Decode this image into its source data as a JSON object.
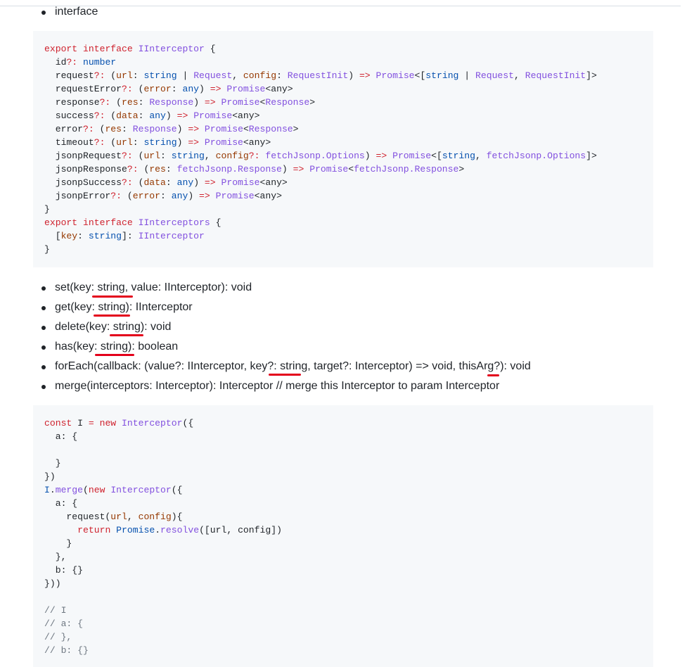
{
  "top_item": "interface",
  "code1": [
    [
      [
        "export ",
        "k"
      ],
      [
        "interface ",
        "k"
      ],
      [
        "IInterceptor",
        "n"
      ],
      [
        " {",
        ""
      ]
    ],
    [
      [
        "  id",
        ""
      ],
      [
        "?: ",
        "k"
      ],
      [
        "number",
        "t"
      ]
    ],
    [
      [
        "  request",
        ""
      ],
      [
        "?: ",
        "k"
      ],
      [
        "(",
        ""
      ],
      [
        "url",
        "p"
      ],
      [
        ": ",
        ""
      ],
      [
        "string",
        "t"
      ],
      [
        " | ",
        ""
      ],
      [
        "Request",
        "n"
      ],
      [
        ", ",
        ""
      ],
      [
        "config",
        "p"
      ],
      [
        ": ",
        ""
      ],
      [
        "RequestInit",
        "n"
      ],
      [
        ") ",
        ""
      ],
      [
        "=>",
        "k"
      ],
      [
        " ",
        ""
      ],
      [
        "Promise",
        "n"
      ],
      [
        "<[",
        ""
      ],
      [
        "string",
        "t"
      ],
      [
        " | ",
        ""
      ],
      [
        "Request",
        "n"
      ],
      [
        ", ",
        ""
      ],
      [
        "RequestInit",
        "n"
      ],
      [
        "]>",
        ""
      ]
    ],
    [
      [
        "  requestError",
        ""
      ],
      [
        "?: ",
        "k"
      ],
      [
        "(",
        ""
      ],
      [
        "error",
        "p"
      ],
      [
        ": ",
        ""
      ],
      [
        "any",
        "t"
      ],
      [
        ") ",
        ""
      ],
      [
        "=>",
        "k"
      ],
      [
        " ",
        ""
      ],
      [
        "Promise",
        "n"
      ],
      [
        "<any>",
        ""
      ]
    ],
    [
      [
        "  response",
        ""
      ],
      [
        "?: ",
        "k"
      ],
      [
        "(",
        ""
      ],
      [
        "res",
        "p"
      ],
      [
        ": ",
        ""
      ],
      [
        "Response",
        "n"
      ],
      [
        ") ",
        ""
      ],
      [
        "=>",
        "k"
      ],
      [
        " ",
        ""
      ],
      [
        "Promise",
        "n"
      ],
      [
        "<",
        ""
      ],
      [
        "Response",
        "n"
      ],
      [
        ">",
        ""
      ]
    ],
    [
      [
        "  success",
        ""
      ],
      [
        "?: ",
        "k"
      ],
      [
        "(",
        ""
      ],
      [
        "data",
        "p"
      ],
      [
        ": ",
        ""
      ],
      [
        "any",
        "t"
      ],
      [
        ") ",
        ""
      ],
      [
        "=>",
        "k"
      ],
      [
        " ",
        ""
      ],
      [
        "Promise",
        "n"
      ],
      [
        "<any>",
        ""
      ]
    ],
    [
      [
        "  error",
        ""
      ],
      [
        "?: ",
        "k"
      ],
      [
        "(",
        ""
      ],
      [
        "res",
        "p"
      ],
      [
        ": ",
        ""
      ],
      [
        "Response",
        "n"
      ],
      [
        ") ",
        ""
      ],
      [
        "=>",
        "k"
      ],
      [
        " ",
        ""
      ],
      [
        "Promise",
        "n"
      ],
      [
        "<",
        ""
      ],
      [
        "Response",
        "n"
      ],
      [
        ">",
        ""
      ]
    ],
    [
      [
        "  timeout",
        ""
      ],
      [
        "?: ",
        "k"
      ],
      [
        "(",
        ""
      ],
      [
        "url",
        "p"
      ],
      [
        ": ",
        ""
      ],
      [
        "string",
        "t"
      ],
      [
        ") ",
        ""
      ],
      [
        "=>",
        "k"
      ],
      [
        " ",
        ""
      ],
      [
        "Promise",
        "n"
      ],
      [
        "<any>",
        ""
      ]
    ],
    [
      [
        "  jsonpRequest",
        ""
      ],
      [
        "?: ",
        "k"
      ],
      [
        "(",
        ""
      ],
      [
        "url",
        "p"
      ],
      [
        ": ",
        ""
      ],
      [
        "string",
        "t"
      ],
      [
        ", ",
        ""
      ],
      [
        "config",
        "p"
      ],
      [
        "?: ",
        "k"
      ],
      [
        "fetchJsonp.Options",
        "n"
      ],
      [
        ") ",
        ""
      ],
      [
        "=>",
        "k"
      ],
      [
        " ",
        ""
      ],
      [
        "Promise",
        "n"
      ],
      [
        "<[",
        ""
      ],
      [
        "string",
        "t"
      ],
      [
        ", ",
        ""
      ],
      [
        "fetchJsonp.Options",
        "n"
      ],
      [
        "]>",
        ""
      ]
    ],
    [
      [
        "  jsonpResponse",
        ""
      ],
      [
        "?: ",
        "k"
      ],
      [
        "(",
        ""
      ],
      [
        "res",
        "p"
      ],
      [
        ": ",
        ""
      ],
      [
        "fetchJsonp.Response",
        "n"
      ],
      [
        ") ",
        ""
      ],
      [
        "=>",
        "k"
      ],
      [
        " ",
        ""
      ],
      [
        "Promise",
        "n"
      ],
      [
        "<",
        ""
      ],
      [
        "fetchJsonp.Response",
        "n"
      ],
      [
        ">",
        ""
      ]
    ],
    [
      [
        "  jsonpSuccess",
        ""
      ],
      [
        "?: ",
        "k"
      ],
      [
        "(",
        ""
      ],
      [
        "data",
        "p"
      ],
      [
        ": ",
        ""
      ],
      [
        "any",
        "t"
      ],
      [
        ") ",
        ""
      ],
      [
        "=>",
        "k"
      ],
      [
        " ",
        ""
      ],
      [
        "Promise",
        "n"
      ],
      [
        "<any>",
        ""
      ]
    ],
    [
      [
        "  jsonpError",
        ""
      ],
      [
        "?: ",
        "k"
      ],
      [
        "(",
        ""
      ],
      [
        "error",
        "p"
      ],
      [
        ": ",
        ""
      ],
      [
        "any",
        "t"
      ],
      [
        ") ",
        ""
      ],
      [
        "=>",
        "k"
      ],
      [
        " ",
        ""
      ],
      [
        "Promise",
        "n"
      ],
      [
        "<any>",
        ""
      ]
    ],
    [
      [
        "}",
        ""
      ]
    ],
    [
      [
        "export ",
        "k"
      ],
      [
        "interface ",
        "k"
      ],
      [
        "IInterceptors",
        "n"
      ],
      [
        " {",
        ""
      ]
    ],
    [
      [
        "  [",
        ""
      ],
      [
        "key",
        "p"
      ],
      [
        ": ",
        ""
      ],
      [
        "string",
        "t"
      ],
      [
        "]: ",
        ""
      ],
      [
        "IInterceptor",
        "n"
      ]
    ],
    [
      [
        "}",
        ""
      ]
    ]
  ],
  "methods": [
    "set(key: string, value: IInterceptor): void",
    "get(key: string): IInterceptor",
    "delete(key: string): void",
    "has(key: string): boolean",
    "forEach(callback: (value?: IInterceptor, key?: string, target?: Interceptor) => void, thisArg?): void",
    "merge(interceptors: Interceptor): Interceptor // merge this Interceptor to param Interceptor"
  ],
  "code2": [
    [
      [
        "const ",
        "k"
      ],
      [
        "I ",
        ""
      ],
      [
        "= ",
        "k"
      ],
      [
        "new ",
        "k"
      ],
      [
        "Interceptor",
        "n"
      ],
      [
        "({",
        ""
      ]
    ],
    [
      [
        "  a: {",
        ""
      ]
    ],
    [
      [
        "",
        ""
      ]
    ],
    [
      [
        "  }",
        ""
      ]
    ],
    [
      [
        "})",
        ""
      ]
    ],
    [
      [
        "I",
        "t"
      ],
      [
        ".",
        ""
      ],
      [
        "merge",
        "n"
      ],
      [
        "(",
        ""
      ],
      [
        "new ",
        "k"
      ],
      [
        "Interceptor",
        "n"
      ],
      [
        "({",
        ""
      ]
    ],
    [
      [
        "  a: {",
        ""
      ]
    ],
    [
      [
        "    request(",
        ""
      ],
      [
        "url",
        "p"
      ],
      [
        ", ",
        ""
      ],
      [
        "config",
        "p"
      ],
      [
        "){",
        ""
      ]
    ],
    [
      [
        "      ",
        ""
      ],
      [
        "return ",
        "k"
      ],
      [
        "Promise",
        "t"
      ],
      [
        ".",
        ""
      ],
      [
        "resolve",
        "n"
      ],
      [
        "([url, config])",
        ""
      ]
    ],
    [
      [
        "    }",
        ""
      ]
    ],
    [
      [
        "  },",
        ""
      ]
    ],
    [
      [
        "  b: {}",
        ""
      ]
    ],
    [
      [
        "}))",
        ""
      ]
    ],
    [
      [
        "",
        ""
      ]
    ],
    [
      [
        "// I",
        "c"
      ]
    ],
    [
      [
        "// a: {",
        "c"
      ]
    ],
    [
      [
        "// },",
        "c"
      ]
    ],
    [
      [
        "// b: {}",
        "c"
      ]
    ]
  ],
  "annotation_color": "#e3001b"
}
